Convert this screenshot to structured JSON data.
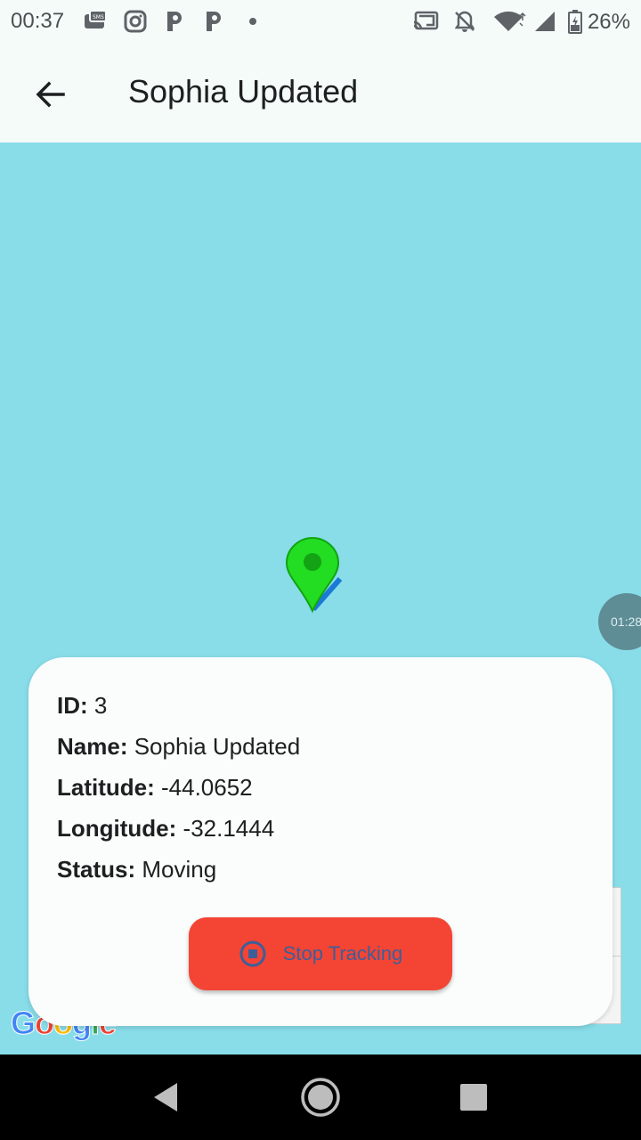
{
  "status_bar": {
    "time": "00:37",
    "battery": "26%",
    "icons": [
      "sms-icon",
      "instagram-icon",
      "p-icon",
      "p-icon",
      "dot-icon",
      "cast-icon",
      "bell-off-icon",
      "wifi-icon",
      "signal-icon",
      "battery-icon"
    ]
  },
  "app_bar": {
    "title": "Sophia Updated",
    "back_icon": "arrow-back-icon"
  },
  "map": {
    "background": "#88dde9",
    "marker_color": "#22dd22",
    "timer_label": "01:28",
    "attribution": "Google"
  },
  "info_card": {
    "id_label": "ID:",
    "id_value": "3",
    "name_label": "Name:",
    "name_value": "Sophia Updated",
    "latitude_label": "Latitude:",
    "latitude_value": "-44.0652",
    "longitude_label": "Longitude:",
    "longitude_value": "-32.1444",
    "status_label": "Status:",
    "status_value": "Moving",
    "button_label": "Stop Tracking",
    "button_color": "#f44434",
    "button_icon": "stop-circle-icon"
  },
  "nav_bar": {
    "buttons": [
      "back-triangle-icon",
      "home-circle-icon",
      "recents-square-icon"
    ]
  }
}
